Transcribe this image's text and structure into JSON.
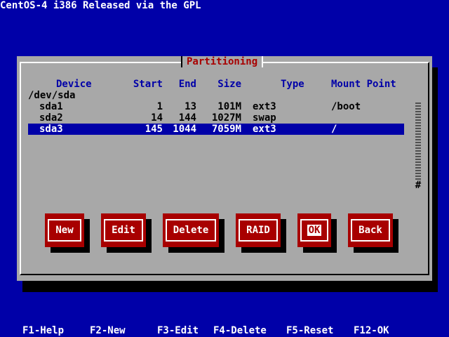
{
  "title": "CentOS-4 i386 Released via the GPL",
  "dialog": {
    "title": "Partitioning",
    "columns": {
      "device": "Device",
      "start": "Start",
      "end": "End",
      "size": "Size",
      "type": "Type",
      "mount": "Mount Point"
    },
    "disk": "/dev/sda",
    "partitions": [
      {
        "device": "sda1",
        "start": "1",
        "end": "13",
        "size": "101M",
        "type": "ext3",
        "mount": "/boot"
      },
      {
        "device": "sda2",
        "start": "14",
        "end": "144",
        "size": "1027M",
        "type": "swap",
        "mount": ""
      },
      {
        "device": "sda3",
        "start": "145",
        "end": "1044",
        "size": "7059M",
        "type": "ext3",
        "mount": "/"
      }
    ],
    "scroll_thumb": "#",
    "buttons": {
      "new": "New",
      "edit": "Edit",
      "delete": "Delete",
      "raid": "RAID",
      "ok": "OK",
      "back": "Back"
    }
  },
  "hotkeys": {
    "help": "F1-Help",
    "new": "F2-New",
    "edit": "F3-Edit",
    "delete": "F4-Delete",
    "reset": "F5-Reset",
    "ok": "F12-OK"
  },
  "colors": {
    "background": "#0000a8",
    "dialog": "#a8a8a8",
    "button": "#a80000",
    "title_text": "#a80000",
    "selection": "#0000a8"
  }
}
